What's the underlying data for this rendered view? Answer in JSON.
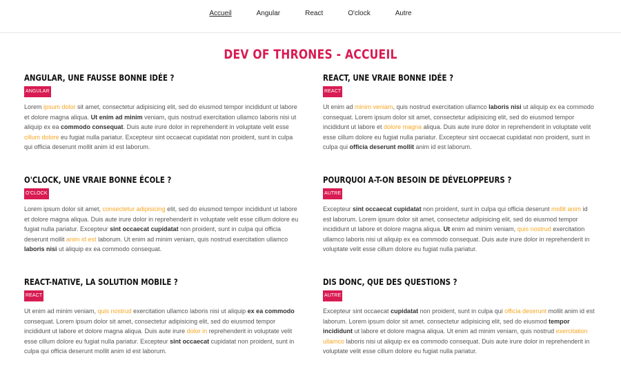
{
  "nav": {
    "items": [
      "Accueil",
      "Angular",
      "React",
      "O'clock",
      "Autre"
    ],
    "active": "Accueil"
  },
  "page": {
    "title": "DEV OF THRONES - ACCUEIL"
  },
  "articles": [
    {
      "title": "ANGULAR, UNE FAUSSE BONNE IDÉE ?",
      "tag": "ANGULAR",
      "body": [
        {
          "t": "Lorem "
        },
        {
          "t": "ipsum dolor",
          "s": "hl"
        },
        {
          "t": " sit amet, consectetur adipisicing elit, sed do eiusmod tempor incididunt ut labore et dolore magna aliqua. "
        },
        {
          "t": "Ut enim ad minim",
          "s": "b"
        },
        {
          "t": " veniam, quis nostrud exercitation ullamco laboris nisi ut aliquip ex ea "
        },
        {
          "t": "commodo consequat",
          "s": "b"
        },
        {
          "t": ". Duis aute irure dolor in reprehenderit in voluptate velit esse "
        },
        {
          "t": "cillum dolore",
          "s": "hl"
        },
        {
          "t": " eu fugiat nulla pariatur. Excepteur sint occaecat cupidatat non proident, sunt in culpa qui officia deserunt mollit anim id est laborum."
        }
      ]
    },
    {
      "title": "REACT, UNE VRAIE BONNE IDÉE ?",
      "tag": "REACT",
      "body": [
        {
          "t": "Ut enim ad "
        },
        {
          "t": "minim veniam",
          "s": "hl"
        },
        {
          "t": ", quis nostrud exercitation ullamco "
        },
        {
          "t": "laboris nisi",
          "s": "b"
        },
        {
          "t": " ut aliquip ex ea commodo consequat. Lorem ipsum dolor sit amet, consectetur adipisicing elit, sed do eiusmod tempor incididunt ut labore et "
        },
        {
          "t": "dolore magna",
          "s": "hl"
        },
        {
          "t": " aliqua. Duis aute irure dolor in reprehenderit in voluptate velit esse cillum dolore eu fugiat nulla pariatur. Excepteur sint occaecat cupidatat non proident, sunt in culpa qui "
        },
        {
          "t": "officia deserunt mollit",
          "s": "b"
        },
        {
          "t": " anim id est laborum."
        }
      ]
    },
    {
      "title": "O'CLOCK, UNE VRAIE BONNE ÉCOLE ?",
      "tag": "O'CLOCK",
      "body": [
        {
          "t": "Lorem ipsum dolor sit amet, "
        },
        {
          "t": "consectetur adipisicing",
          "s": "hl"
        },
        {
          "t": " elit, sed do eiusmod tempor incididunt ut labore et dolore magna aliqua. Duis aute irure dolor in reprehenderit in voluptate velit esse cillum dolore eu fugiat nulla pariatur. Excepteur "
        },
        {
          "t": "sint occaecat cupidatat",
          "s": "b"
        },
        {
          "t": " non proident, sunt in culpa qui officia deserunt mollit "
        },
        {
          "t": "anim id est",
          "s": "hl"
        },
        {
          "t": " laborum. Ut enim ad minim veniam, quis nostrud exercitation ullamco "
        },
        {
          "t": "laboris nisi",
          "s": "b"
        },
        {
          "t": " ut aliquip ex ea commodo consequat."
        }
      ]
    },
    {
      "title": "POURQUOI A-T-ON BESOIN DE DÉVELOPPEURS ?",
      "tag": "AUTRE",
      "body": [
        {
          "t": "Excepteur "
        },
        {
          "t": "sint occaecat cupidatat",
          "s": "b"
        },
        {
          "t": " non proident, sunt in culpa qui officia deserunt "
        },
        {
          "t": "mollit anim",
          "s": "hl"
        },
        {
          "t": " id est laborum. Lorem ipsum dolor sit amet, consectetur adipisicing elit, sed do eiusmod tempor incididunt ut labore et dolore magna aliqua. "
        },
        {
          "t": "Ut",
          "s": "b"
        },
        {
          "t": " enim ad minim veniam, "
        },
        {
          "t": "quis nostrud",
          "s": "hl"
        },
        {
          "t": " exercitation ullamco laboris nisi ut aliquip ex ea commodo consequat. Duis aute irure dolor in reprehenderit in voluptate velit esse cillum dolore eu fugiat nulla pariatur."
        }
      ]
    },
    {
      "title": "REACT-NATIVE, LA SOLUTION MOBILE ?",
      "tag": "REACT",
      "body": [
        {
          "t": "Ut enim ad minim veniam, "
        },
        {
          "t": "quis nostrud",
          "s": "hl"
        },
        {
          "t": " exercitation ullamco laboris nisi ut aliquip "
        },
        {
          "t": "ex ea commodo",
          "s": "b"
        },
        {
          "t": " consequat. Lorem ipsum dolor sit amet, consectetur adipisicing elit, sed do eiusmod tempor incididunt ut labore et dolore magna aliqua. Duis aute irure "
        },
        {
          "t": "dolor in",
          "s": "hl"
        },
        {
          "t": " reprehenderit in voluptate velit esse cillum dolore eu fugiat nulla pariatur. Excepteur "
        },
        {
          "t": "sint occaecat",
          "s": "b"
        },
        {
          "t": " cupidatat non proident, sunt in culpa qui officia deserunt mollit anim id est laborum."
        }
      ]
    },
    {
      "title": "DIS DONC, QUE DES QUESTIONS ?",
      "tag": "AUTRE",
      "body": [
        {
          "t": "Excepteur sint occaecat "
        },
        {
          "t": "cupidatat",
          "s": "b"
        },
        {
          "t": " non proident, sunt in culpa qui "
        },
        {
          "t": "officia deserunt",
          "s": "hl"
        },
        {
          "t": " mollit anim id est laborum. Lorem ipsum dolor sit amet. consectetur adipisicing elit, sed do eiusmod "
        },
        {
          "t": "tempor incididunt",
          "s": "b"
        },
        {
          "t": " ut labore et dolore magna aliqua. Ut enim ad minim veniam, quis nostrud "
        },
        {
          "t": "exercitation ullamco",
          "s": "hl"
        },
        {
          "t": " laboris nisi ut aliquip ex ea commodo consequat. Duis aute irure dolor in reprehenderit in voluptate velit esse cillum dolore eu fugiat nulla pariatur."
        }
      ]
    }
  ],
  "colors": {
    "accent": "#d81b52",
    "highlight": "#f5a623",
    "text": "#555555"
  }
}
